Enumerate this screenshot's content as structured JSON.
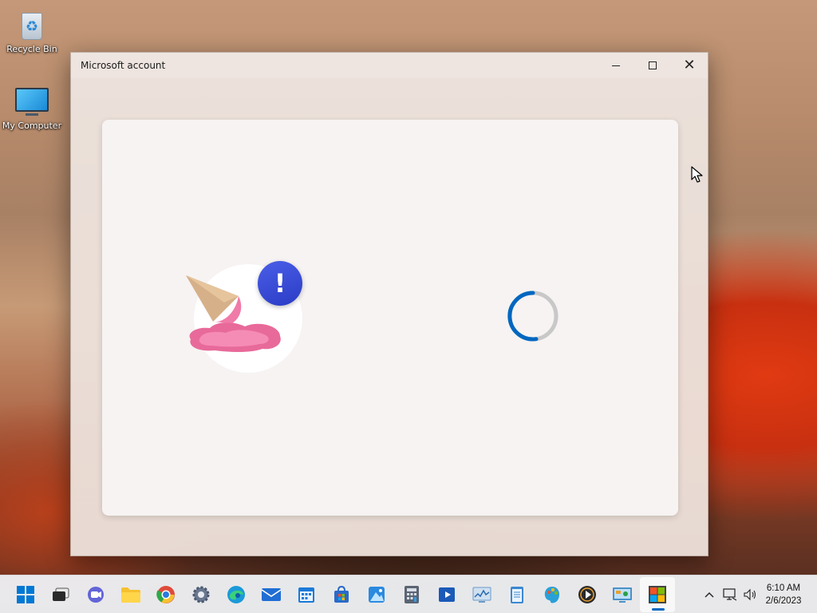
{
  "desktop": {
    "icons": [
      {
        "label": "Recycle Bin",
        "icon": "recycle-bin-icon"
      },
      {
        "label": "My Computer",
        "icon": "monitor-icon"
      }
    ]
  },
  "window": {
    "title": "Microsoft account",
    "controls": {
      "minimize": "minimize",
      "maximize": "maximize",
      "close": "close"
    },
    "illustration": {
      "name": "melted-ice-cream-error",
      "badge": "!",
      "badge_color": "#3a4ed8"
    },
    "spinner": {
      "state": "loading",
      "color": "#0067c0",
      "track_color": "#c8c8c8"
    }
  },
  "taskbar": {
    "apps": [
      {
        "name": "start",
        "icon": "windows-logo-icon",
        "glyph": "",
        "color": "#0078d4"
      },
      {
        "name": "task-view",
        "icon": "task-view-icon",
        "glyph": "",
        "color": "#202020"
      },
      {
        "name": "teams-chat",
        "icon": "chat-icon",
        "glyph": "",
        "color": "#6264d8"
      },
      {
        "name": "file-explorer",
        "icon": "folder-icon",
        "glyph": "",
        "color": "#f5c12e"
      },
      {
        "name": "chrome",
        "icon": "chrome-icon",
        "glyph": "",
        "color": "#de4a3a"
      },
      {
        "name": "settings",
        "icon": "gear-icon",
        "glyph": "⚙",
        "color": "#5a6a80"
      },
      {
        "name": "edge",
        "icon": "edge-icon",
        "glyph": "",
        "color": "#1a9ad8"
      },
      {
        "name": "mail",
        "icon": "mail-icon",
        "glyph": "✉",
        "color": "#1f6ed4"
      },
      {
        "name": "calendar",
        "icon": "calendar-icon",
        "glyph": "",
        "color": "#1a7ad8"
      },
      {
        "name": "store",
        "icon": "store-bag-icon",
        "glyph": "",
        "color": "#2a6ac8"
      },
      {
        "name": "photos",
        "icon": "photos-icon",
        "glyph": "",
        "color": "#2a8ae0"
      },
      {
        "name": "calculator",
        "icon": "calculator-icon",
        "glyph": "",
        "color": "#5a6472"
      },
      {
        "name": "media-player",
        "icon": "media-player-icon",
        "glyph": "▶",
        "color": "#1a5ab8"
      },
      {
        "name": "performance-monitor",
        "icon": "chart-monitor-icon",
        "glyph": "",
        "color": "#6a9ac8"
      },
      {
        "name": "notepad",
        "icon": "notepad-icon",
        "glyph": "",
        "color": "#3a88d0"
      },
      {
        "name": "paint",
        "icon": "palette-icon",
        "glyph": "",
        "color": "#2aa0d8"
      },
      {
        "name": "video-player",
        "icon": "play-circle-icon",
        "glyph": "▶",
        "color": "#2a2a2a"
      },
      {
        "name": "control-panel",
        "icon": "control-panel-icon",
        "glyph": "",
        "color": "#4a90c8"
      },
      {
        "name": "microsoft-store",
        "icon": "microsoft-logo-icon",
        "glyph": "",
        "color": "#444",
        "active": true
      }
    ],
    "tray": {
      "chevron": "^",
      "network": "network-icon",
      "volume": "volume-icon",
      "time": "6:10 AM",
      "date": "2/6/2023"
    }
  }
}
